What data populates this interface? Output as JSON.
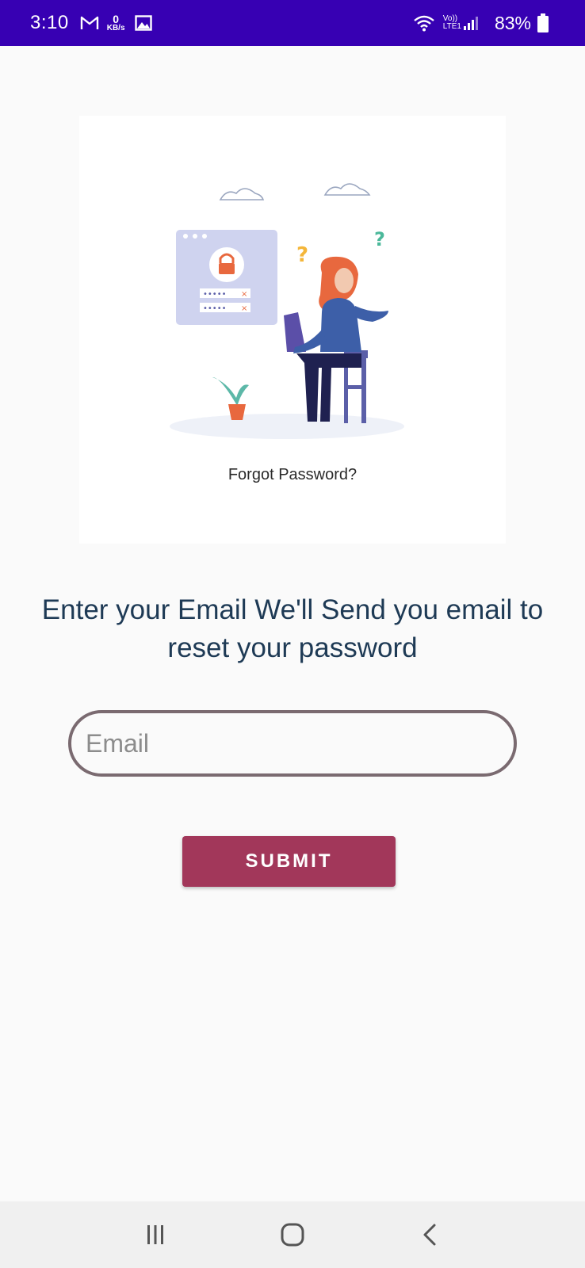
{
  "status_bar": {
    "time": "3:10",
    "data_speed_value": "0",
    "data_speed_unit": "KB/s",
    "volte_label": "Vo))",
    "lte_label": "LTE1",
    "battery_percent": "83%",
    "icons": [
      "gmail-icon",
      "image-icon",
      "wifi-icon",
      "signal-icon",
      "battery-icon"
    ]
  },
  "illustration": {
    "caption": "Forgot Password?"
  },
  "main": {
    "instruction": "Enter your Email We'll Send you email to reset your password",
    "email_placeholder": "Email",
    "email_value": "",
    "submit_label": "SUBMIT"
  },
  "nav_bar": {
    "icons": [
      "recent-apps-icon",
      "home-icon",
      "back-icon"
    ]
  },
  "colors": {
    "status_bar": "#3700b3",
    "submit_button": "#a2375a",
    "input_border": "#7a6a70",
    "instruction_text": "#1e3a55",
    "background": "#fafafa"
  }
}
